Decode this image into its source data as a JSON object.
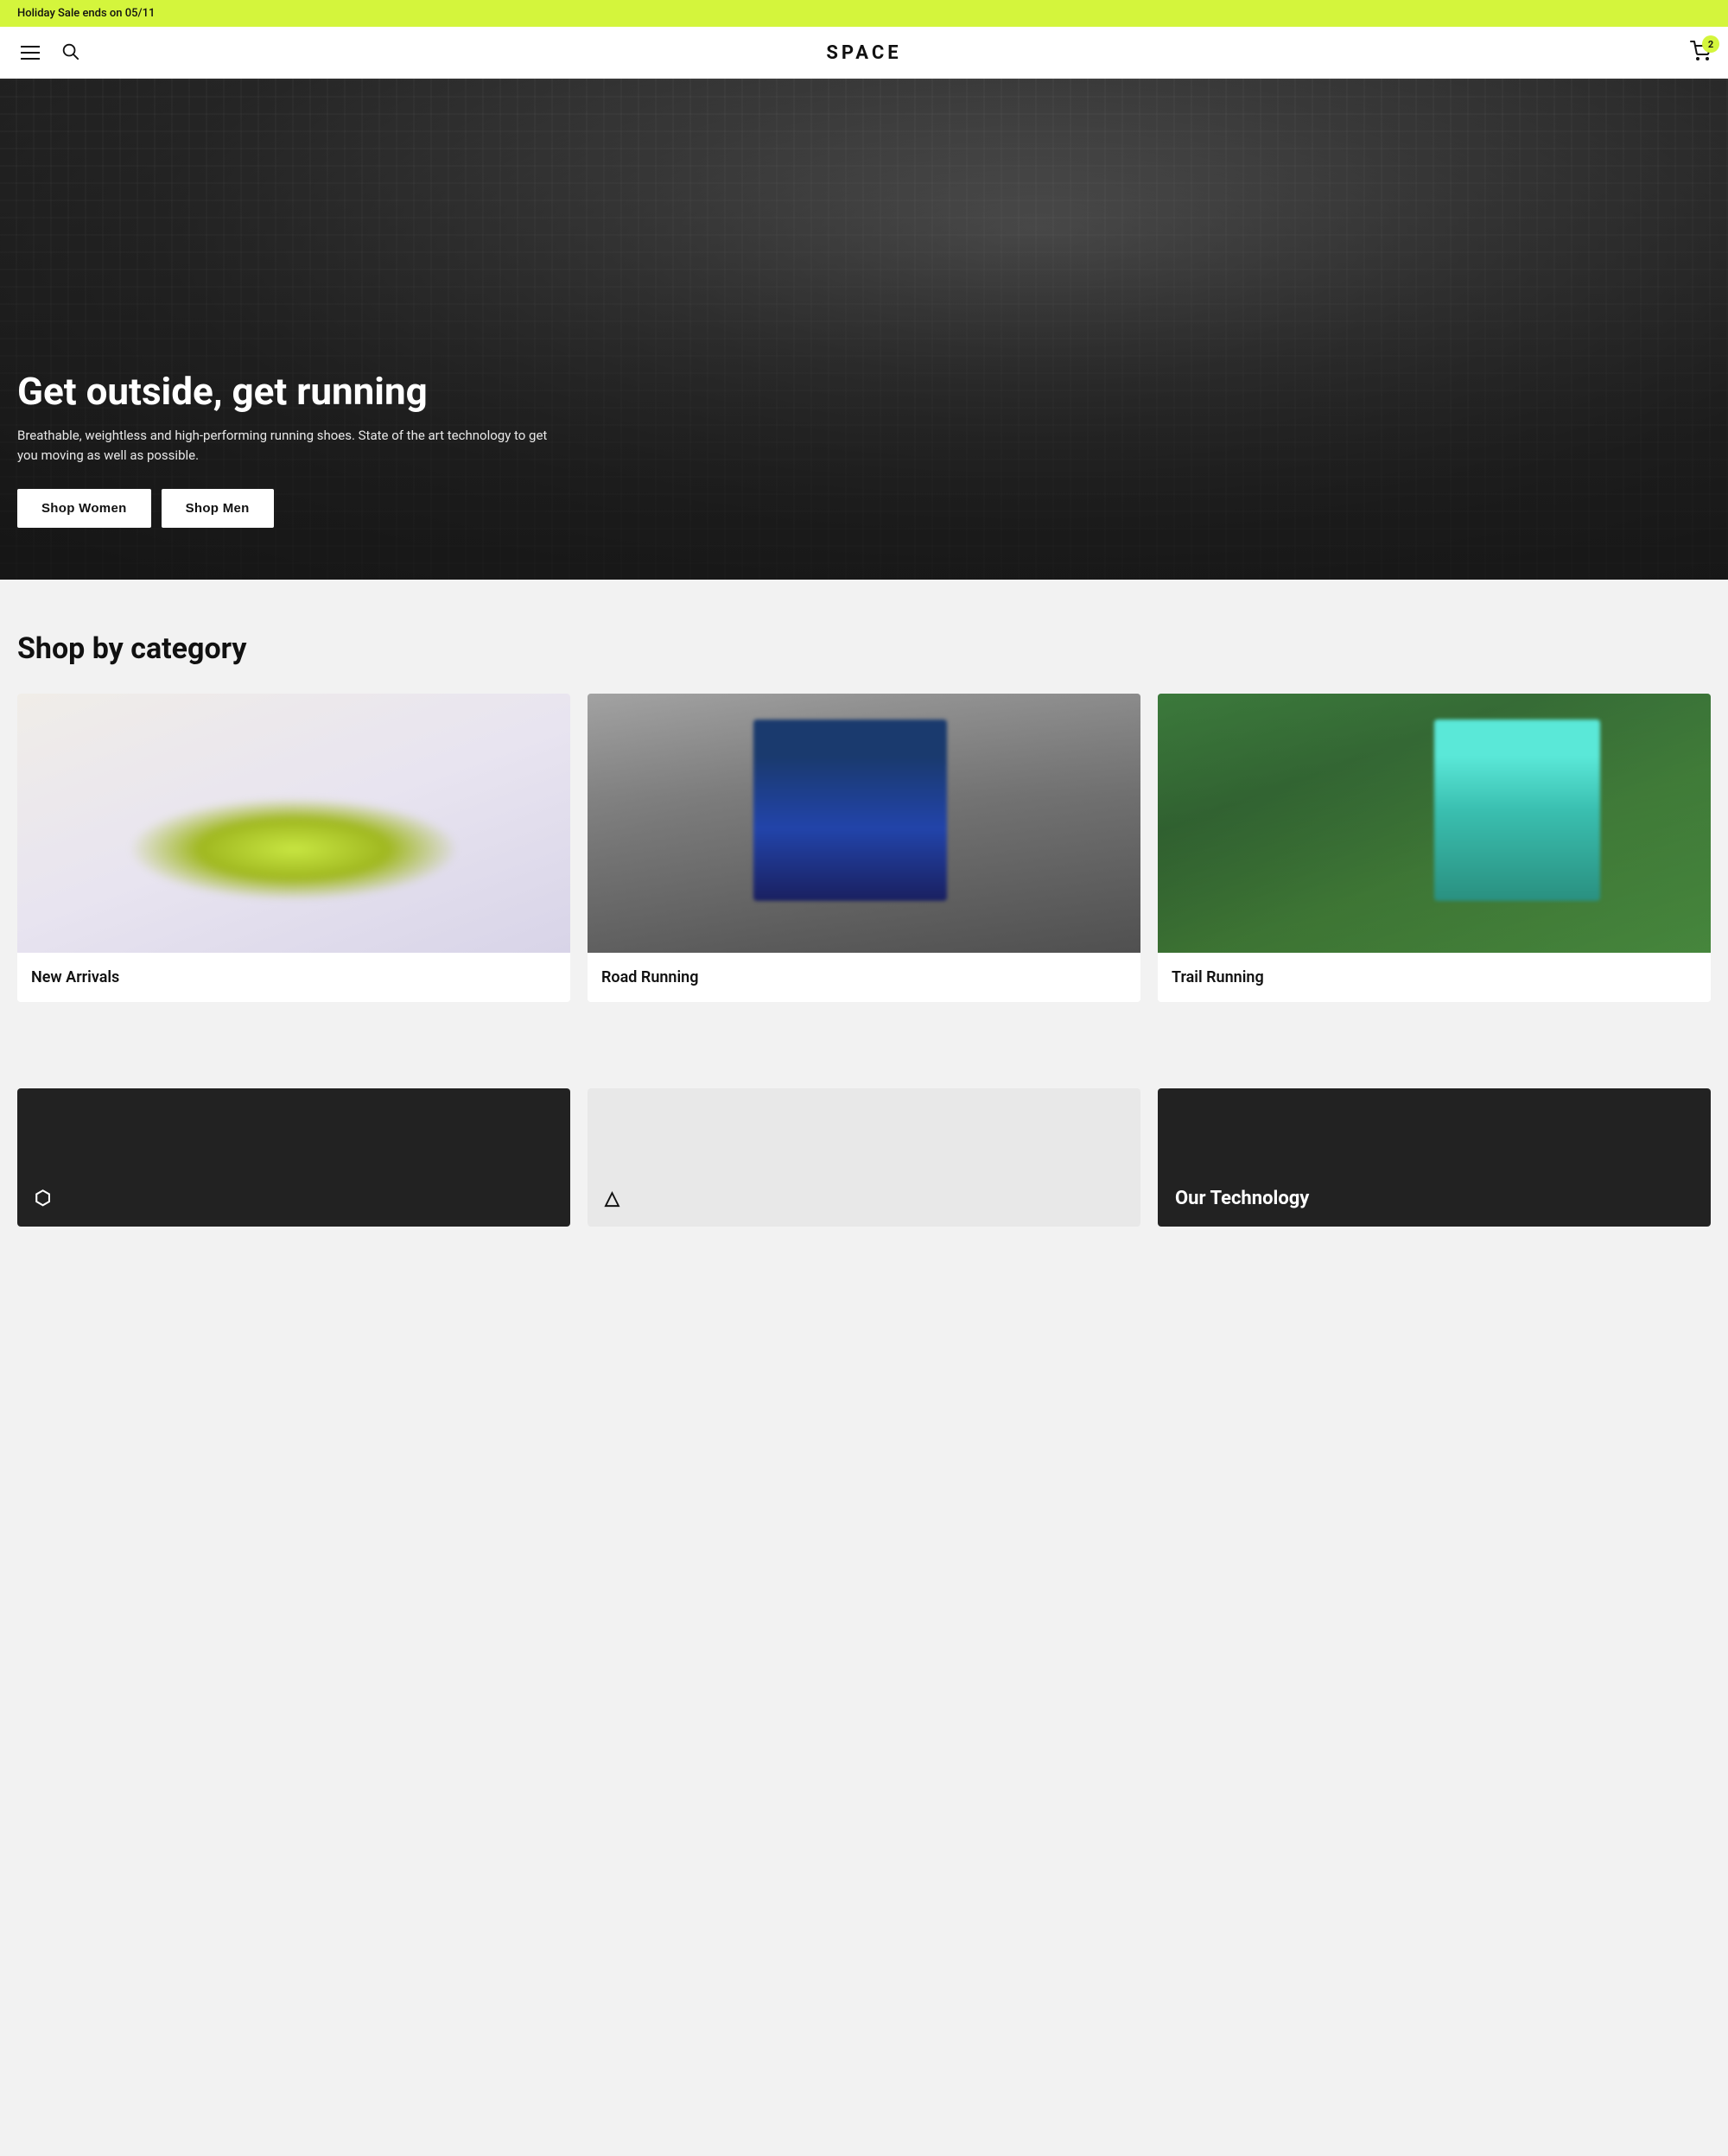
{
  "announcement": {
    "text": "Holiday Sale ends on 05/11"
  },
  "header": {
    "logo": "SPACE",
    "cart_count": "2"
  },
  "hero": {
    "title": "Get outside, get running",
    "subtitle": "Breathable, weightless and high-performing running shoes. State of the art technology to get you moving as well as possible.",
    "btn_women": "Shop Women",
    "btn_men": "Shop Men"
  },
  "categories": {
    "section_title": "Shop by category",
    "items": [
      {
        "label": "New Arrivals",
        "image_type": "new-arrivals"
      },
      {
        "label": "Road Running",
        "image_type": "road-running"
      },
      {
        "label": "Trail Running",
        "image_type": "trail-running"
      }
    ]
  },
  "tech_section": {
    "section_title": "Our Technology"
  }
}
